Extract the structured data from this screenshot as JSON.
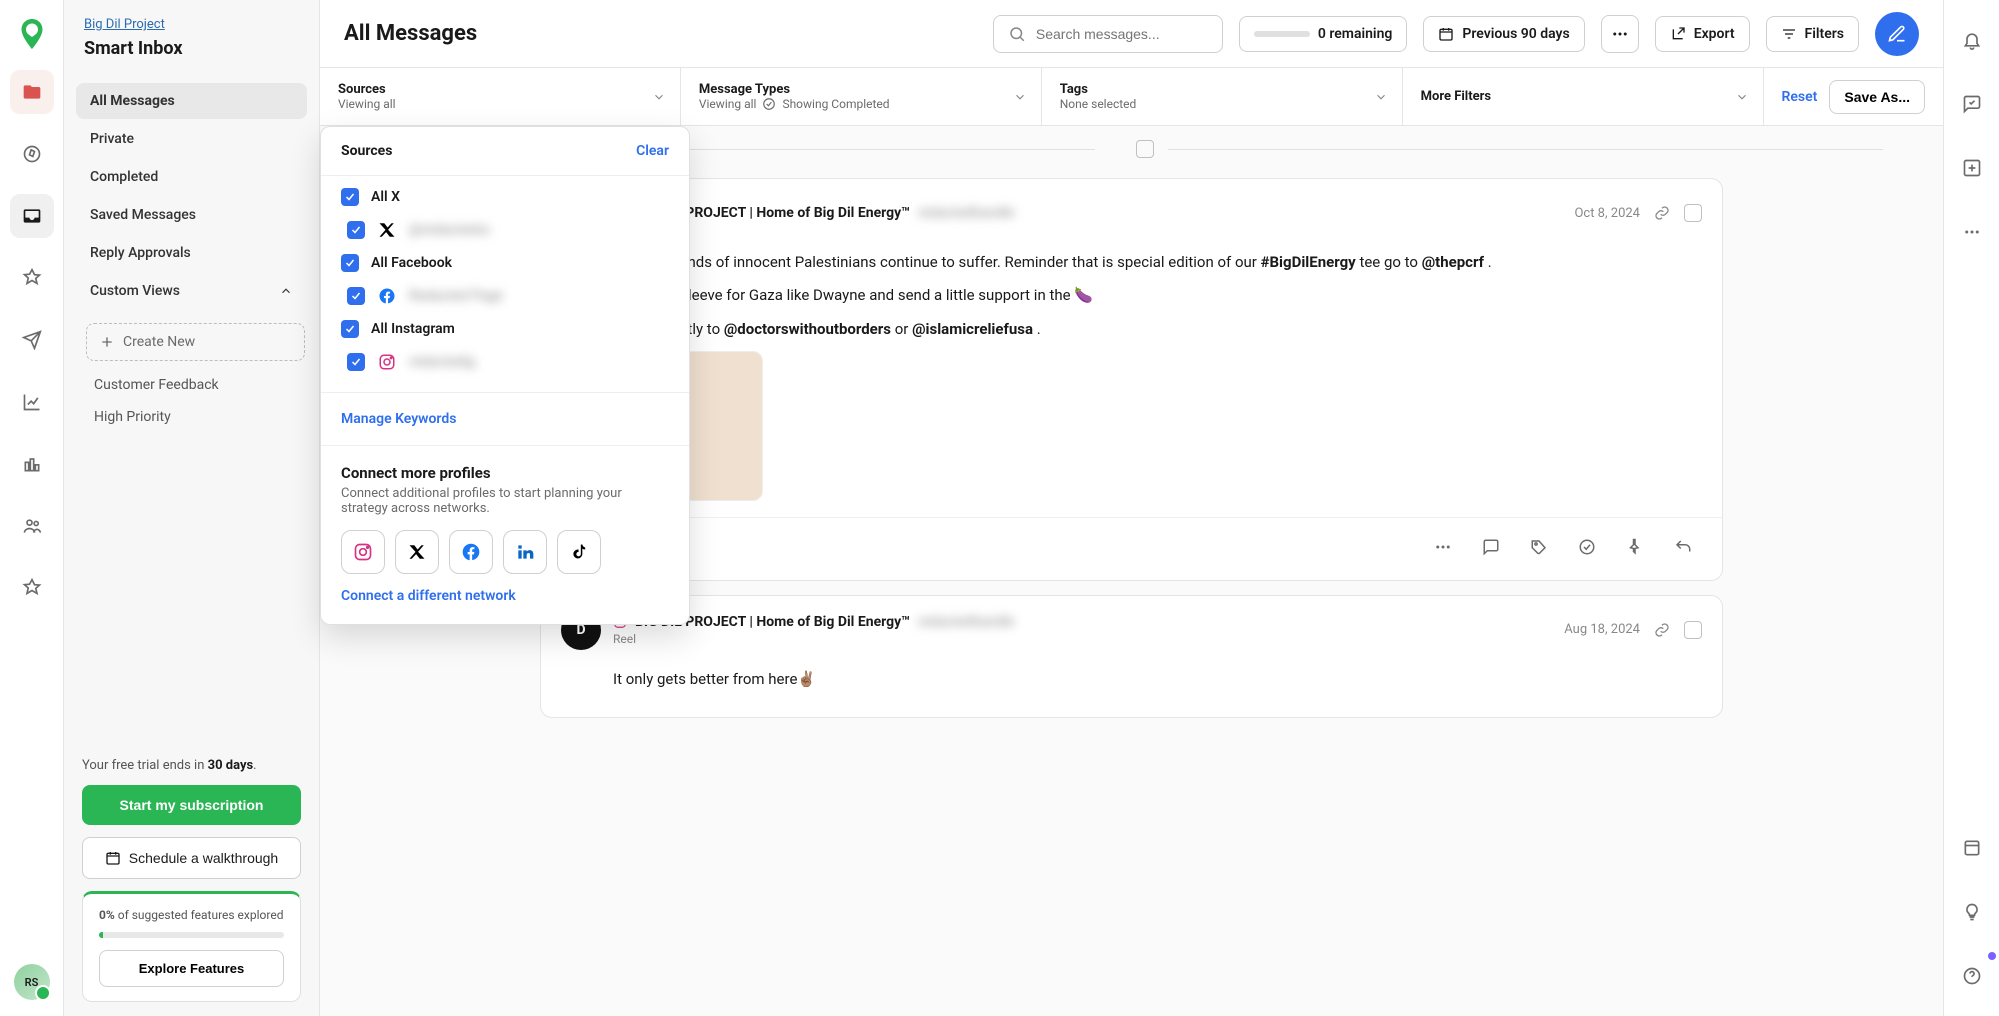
{
  "breadcrumb": "Big Dil Project",
  "workspace_title": "Smart Inbox",
  "sidebar": {
    "items": [
      {
        "label": "All Messages",
        "active": true
      },
      {
        "label": "Private"
      },
      {
        "label": "Completed"
      },
      {
        "label": "Saved Messages"
      },
      {
        "label": "Reply Approvals"
      }
    ],
    "custom_views_label": "Custom Views",
    "create_new_label": "Create New",
    "custom_links": [
      {
        "label": "Customer Feedback"
      },
      {
        "label": "High Priority"
      }
    ],
    "trial_prefix": "Your free trial ends in ",
    "trial_days": "30 days",
    "trial_suffix": ".",
    "start_subscription": "Start my subscription",
    "schedule_walkthrough": "Schedule a walkthrough",
    "progress_pct": "0%",
    "progress_text": " of suggested features explored",
    "explore_features": "Explore Features"
  },
  "header": {
    "title": "All Messages",
    "search_placeholder": "Search messages...",
    "remaining": "0 remaining",
    "previous_days": "Previous 90 days",
    "export": "Export",
    "filters": "Filters"
  },
  "filters": {
    "sources_label": "Sources",
    "sources_value": "Viewing all",
    "types_label": "Message Types",
    "types_value_prefix": "Viewing all",
    "types_value_suffix": "Showing Completed",
    "tags_label": "Tags",
    "tags_value": "None selected",
    "more_label": "More Filters",
    "reset": "Reset",
    "save_as": "Save As..."
  },
  "dropdown": {
    "title": "Sources",
    "clear": "Clear",
    "all_x": "All X",
    "x_handle": "@redactedxx",
    "all_facebook": "All Facebook",
    "fb_page": "Redacted Page",
    "all_instagram": "All Instagram",
    "ig_handle": "redactedig",
    "manage_keywords": "Manage Keywords",
    "connect_title": "Connect more profiles",
    "connect_sub": "Connect additional profiles to start planning your strategy across networks.",
    "connect_different": "Connect a different network"
  },
  "messages": {
    "day1": {
      "date_label": "Oct 8, 2024",
      "author": "BIG DIL PROJECT | Home of Big Dil Energy™",
      "handle": "redactedhandle",
      "body1_pre": "and thousands of innocent Palestinians continue to suffer. Reminder that ",
      "body1_mid": "is special edition of our ",
      "hashtag": "#BigDilEnergy",
      "body1_post": " tee go to ",
      "mention1": "@thepcrf",
      "body1_end": ".",
      "body2_pre": "rt on your sleeve for Gaza like Dwayne and send a little support in the ",
      "emoji": "🍆",
      "body3_pre": "onate directly to ",
      "mention2": "@doctorswithoutborders",
      "body3_mid": " or ",
      "mention3": "@islamicreliefusa",
      "body3_end": "."
    },
    "day2": {
      "date_label": "Aug 18, 2024",
      "author": "BIG DIL PROJECT | Home of Big Dil Energy™",
      "handle": "redactedhandle",
      "subtype": "Reel",
      "body": "It only gets better from here✌🏽"
    }
  },
  "avatar_initials": "RS"
}
